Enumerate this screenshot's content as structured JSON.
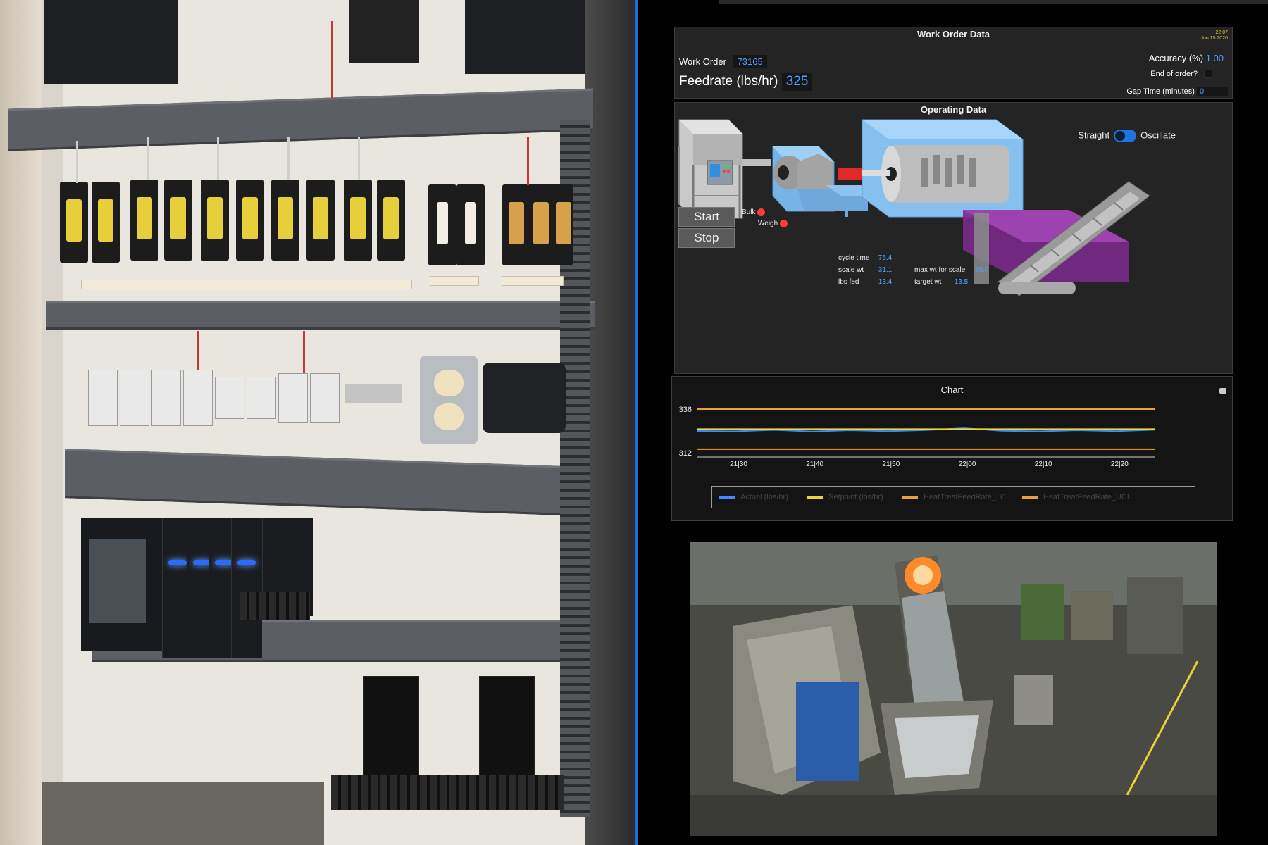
{
  "work_order": {
    "title": "Work Order Data",
    "timestamp_time": "22:07",
    "timestamp_date": "Jun 15 2020",
    "work_order_label": "Work Order",
    "work_order_value": "73165",
    "feedrate_label": "Feedrate (lbs/hr)",
    "feedrate_value": "325",
    "accuracy_label": "Accuracy (%)",
    "accuracy_value": "1.00",
    "end_of_order_label": "End of order?",
    "gap_time_label": "Gap Time (minutes)",
    "gap_time_value": "0"
  },
  "operating": {
    "title": "Operating Data",
    "start_label": "Start",
    "stop_label": "Stop",
    "bulk_label": "Bulk",
    "weigh_label": "Weigh",
    "straight_label": "Straight",
    "oscillate_label": "Oscillate",
    "cycle_time_label": "cycle time",
    "cycle_time_value": "75.4",
    "scale_wt_label": "scale wt",
    "scale_wt_value": "31.1",
    "lbs_fed_label": "lbs fed",
    "lbs_fed_value": "13.4",
    "max_wt_label": "max wt for scale",
    "max_wt_value": "39.0",
    "target_wt_label": "target wt",
    "target_wt_value": "13.5",
    "indicator_color": "#ff3b3b",
    "toggle_color": "#1e74e0"
  },
  "chart_panel": {
    "title": "Chart"
  },
  "chart_data": {
    "type": "line",
    "title": "Chart",
    "x": [
      "21:25",
      "21:30",
      "21:35",
      "21:40",
      "21:45",
      "21:50",
      "21:55",
      "22:00",
      "22:05",
      "22:10",
      "22:15",
      "22:20",
      "22:25"
    ],
    "tick_labels": [
      "21|30",
      "21|40",
      "21|50",
      "22|00",
      "22|10",
      "22|20"
    ],
    "y_tick_labels": [
      "336",
      "312"
    ],
    "ylim": [
      312,
      336
    ],
    "grid": false,
    "legend_position": "bottom",
    "series": [
      {
        "name": "Actual (lbs/hr)",
        "color": "#3d8bff",
        "values": [
          324,
          323.8,
          324.6,
          323.7,
          324.4,
          323.9,
          324.5,
          325.5,
          324.1,
          323.8,
          324.4,
          323.9,
          324.7
        ]
      },
      {
        "name": "Setpoint (lbs/hr)",
        "color": "#e8d73a",
        "values": [
          325,
          325,
          325,
          325,
          325,
          325,
          325,
          325,
          325,
          325,
          325,
          325,
          325
        ]
      },
      {
        "name": "HeatTreatFeedRate_LCL",
        "color": "#e9a23b",
        "values": [
          314,
          314,
          314,
          314,
          314,
          314,
          314,
          314,
          314,
          314,
          314,
          314,
          314
        ]
      },
      {
        "name": "HeatTreatFeedRate_UCL",
        "color": "#e9a23b",
        "values": [
          336,
          336,
          336,
          336,
          336,
          336,
          336,
          336,
          336,
          336,
          336,
          336,
          336
        ]
      }
    ]
  }
}
